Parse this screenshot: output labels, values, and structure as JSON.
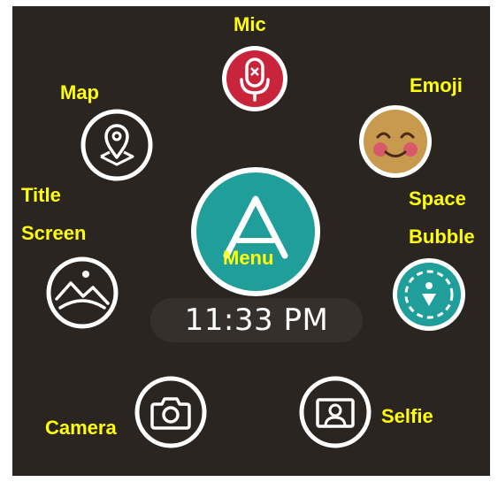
{
  "menu": {
    "center_label": "Menu",
    "clock": "11:33 PM",
    "items": [
      {
        "label": "Mic"
      },
      {
        "label": "Emoji"
      },
      {
        "label": "Map"
      },
      {
        "label_line1": "Title",
        "label_line2": "Screen"
      },
      {
        "label_line1": "Space",
        "label_line2": "Bubble"
      },
      {
        "label": "Camera"
      },
      {
        "label": "Selfie"
      }
    ]
  },
  "colors": {
    "background": "#2a2520",
    "label": "#ffff0a",
    "accent_teal": "#1f9e9a",
    "mic_red": "#c8243c",
    "emoji_face": "#c89a4e",
    "emoji_cheek": "#d85a6a"
  }
}
